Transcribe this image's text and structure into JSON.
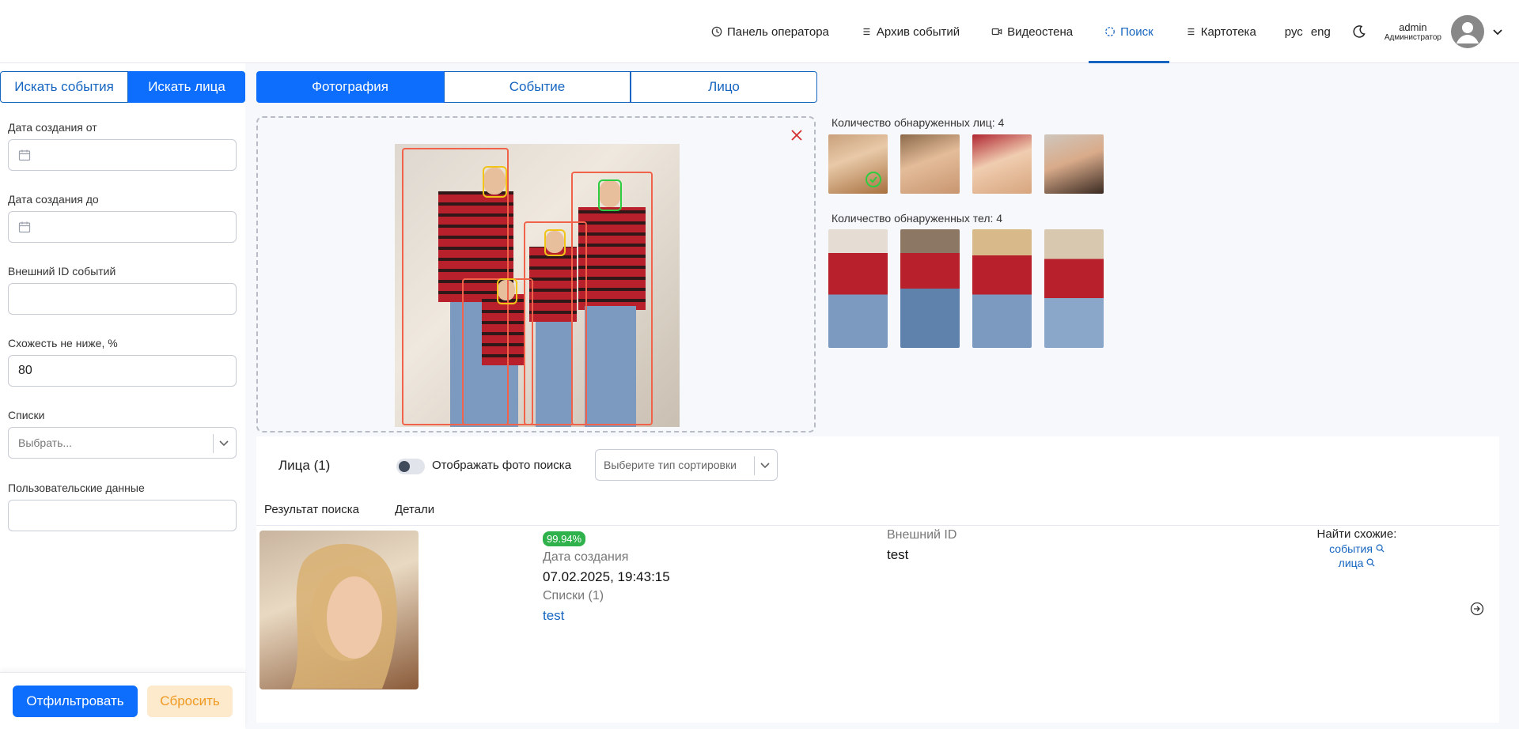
{
  "header": {
    "nav": [
      {
        "label": "Панель оператора",
        "icon": "clock-icon"
      },
      {
        "label": "Архив событий",
        "icon": "list-icon"
      },
      {
        "label": "Видеостена",
        "icon": "video-icon"
      },
      {
        "label": "Поиск",
        "icon": "search-target-icon",
        "active": true
      },
      {
        "label": "Картотека",
        "icon": "list-icon"
      }
    ],
    "lang_ru": "рус",
    "lang_en": "eng",
    "user_name": "admin",
    "user_role": "Администратор"
  },
  "sidebar": {
    "tabs": [
      "Искать события",
      "Искать лица"
    ],
    "active_tab": 1,
    "date_from_label": "Дата создания от",
    "date_to_label": "Дата создания до",
    "external_id_label": "Внешний ID событий",
    "similarity_label": "Схожесть не ниже, %",
    "similarity_value": "80",
    "lists_label": "Списки",
    "lists_placeholder": "Выбрать...",
    "userdata_label": "Пользовательские данные",
    "filter_button": "Отфильтровать",
    "reset_button": "Сбросить"
  },
  "mode_tabs": [
    "Фотография",
    "Событие",
    "Лицо"
  ],
  "active_mode": 0,
  "detected": {
    "faces_label": "Количество обнаруженных лиц: 4",
    "bodies_label": "Количество обнаруженных тел: 4"
  },
  "results": {
    "title": "Лица (1)",
    "toggle_label": "Отображать фото поиска",
    "sort_placeholder": "Выберите тип сортировки",
    "col_result": "Результат поиска",
    "col_details": "Детали",
    "items": [
      {
        "score": "99.94%",
        "created_label": "Дата создания",
        "created_value": "07.02.2025, 19:43:15",
        "lists_label": "Списки (1)",
        "lists_value": "test",
        "external_id_label": "Внешний ID",
        "external_id_value": "test",
        "find_similar": "Найти схожие:",
        "find_events": "события",
        "find_faces": "лица"
      }
    ]
  },
  "colors": {
    "primary": "#0d6efd",
    "accent": "#1565c0",
    "reset_bg": "#fde9cc",
    "reset_text": "#f09a22",
    "badge": "#2fb24c",
    "body_box": "#f0634a",
    "face_box": "#f2c418",
    "selected_face_box": "#2ecc40"
  }
}
